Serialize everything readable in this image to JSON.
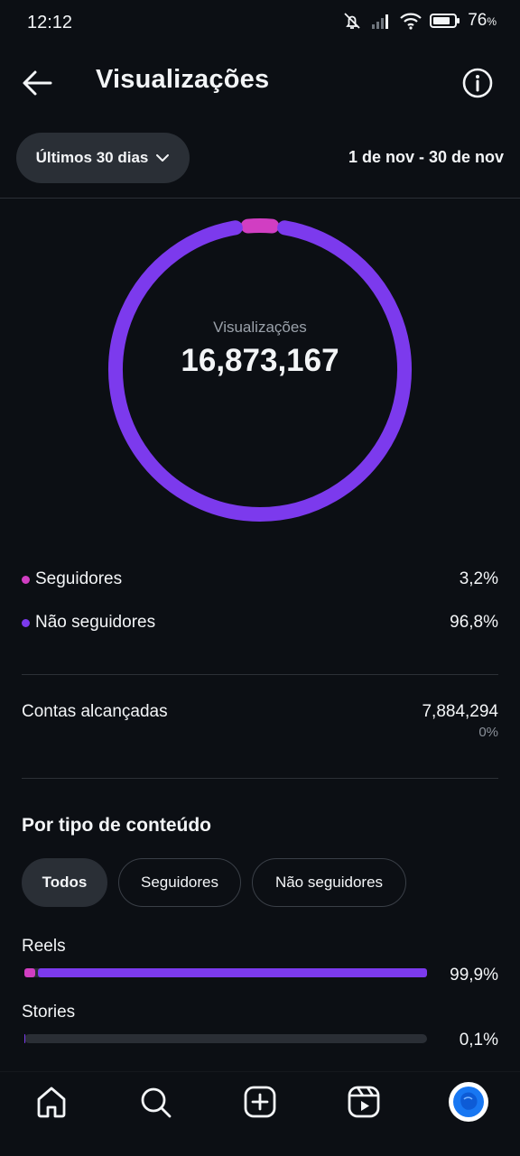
{
  "status_bar": {
    "time": "12:12",
    "battery_percent": "76",
    "battery_unit": "%"
  },
  "header": {
    "title": "Visualizações",
    "back_icon": "back-arrow-icon",
    "info_icon": "info-icon"
  },
  "filters": {
    "period_label": "Últimos 30 dias",
    "date_range": "1 de nov - 30 de nov"
  },
  "summary": {
    "label": "Visualizações",
    "value": "16,873,167"
  },
  "colors": {
    "followers": "#d13ec2",
    "non_followers": "#7c3aed",
    "bg": "#0c0f14"
  },
  "audience": [
    {
      "label": "Seguidores",
      "value": "3,2%",
      "fraction": 0.032,
      "color": "#d13ec2"
    },
    {
      "label": "Não seguidores",
      "value": "96,8%",
      "fraction": 0.968,
      "color": "#7c3aed"
    }
  ],
  "reach": {
    "label": "Contas alcançadas",
    "value": "7,884,294",
    "change": "0%"
  },
  "content_type": {
    "title": "Por tipo de conteúdo",
    "tabs": [
      "Todos",
      "Seguidores",
      "Não seguidores"
    ],
    "active_tab": "Todos",
    "items": [
      {
        "label": "Reels",
        "value": "99,9%",
        "share": 0.999,
        "followers_share": 0.03
      },
      {
        "label": "Stories",
        "value": "0,1%",
        "share": 0.001,
        "followers_share": 0
      }
    ]
  },
  "bottom_nav": [
    "home-icon",
    "search-icon",
    "create-icon",
    "reels-icon",
    "profile-avatar"
  ]
}
